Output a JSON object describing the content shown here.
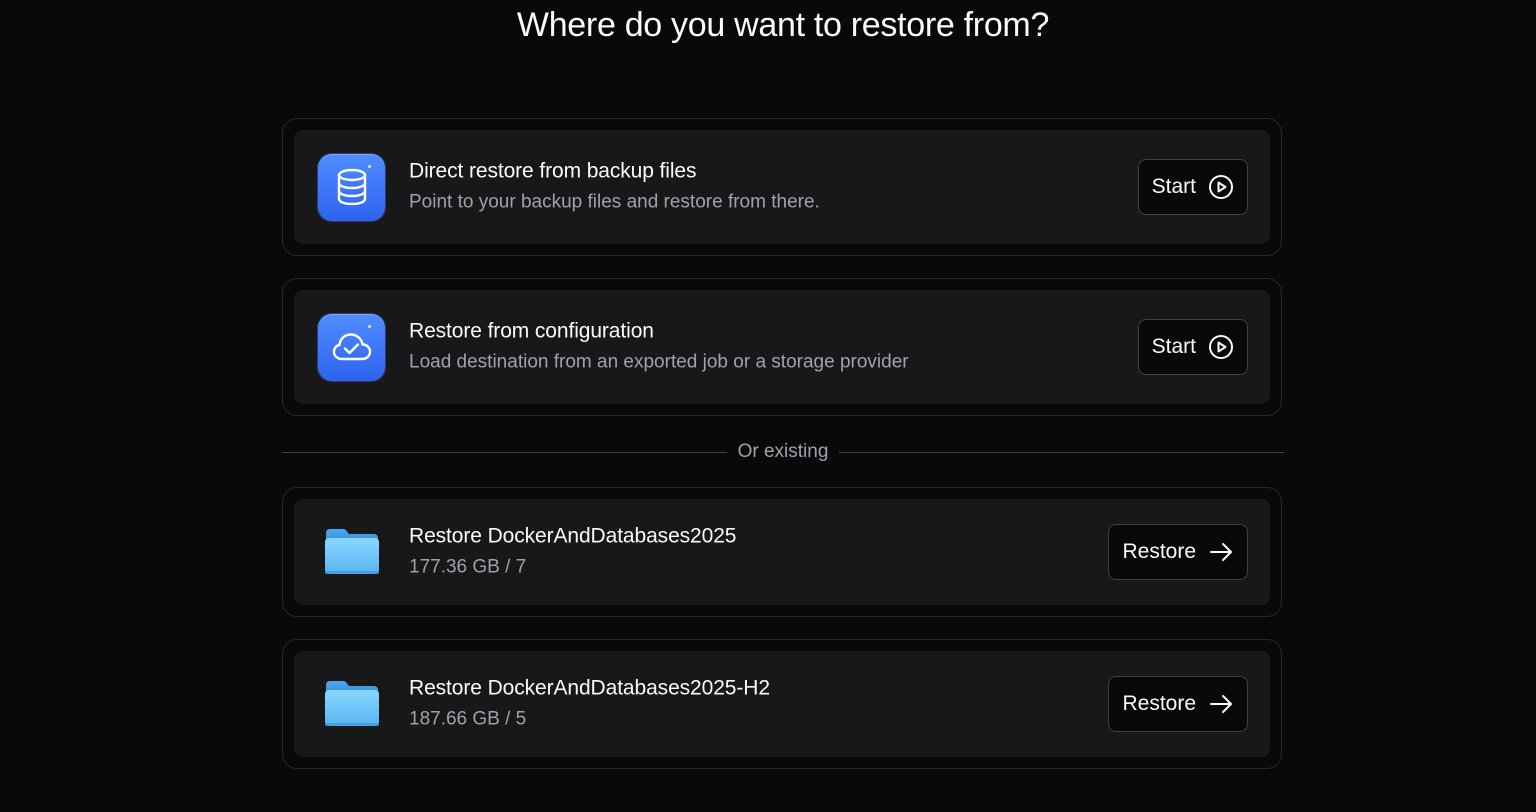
{
  "page": {
    "title": "Where do you want to restore from?"
  },
  "options": [
    {
      "title": "Direct restore from backup files",
      "subtitle": "Point to your backup files and restore from there.",
      "button_label": "Start",
      "icon": "database-icon"
    },
    {
      "title": "Restore from configuration",
      "subtitle": "Load destination from an exported job or a storage provider",
      "button_label": "Start",
      "icon": "cloud-check-icon"
    }
  ],
  "divider": {
    "label": "Or existing"
  },
  "existing": [
    {
      "title": "Restore DockerAndDatabases2025",
      "subtitle": "177.36 GB / 7",
      "button_label": "Restore",
      "icon": "folder-icon"
    },
    {
      "title": "Restore DockerAndDatabases2025-H2",
      "subtitle": "187.66 GB / 5",
      "button_label": "Restore",
      "icon": "folder-icon"
    }
  ],
  "colors": {
    "background": "#09090b",
    "card": "#18181b",
    "accent_blue": "#3b73ff",
    "folder_blue": "#6cc4f5",
    "muted_text": "#a1a1aa"
  }
}
